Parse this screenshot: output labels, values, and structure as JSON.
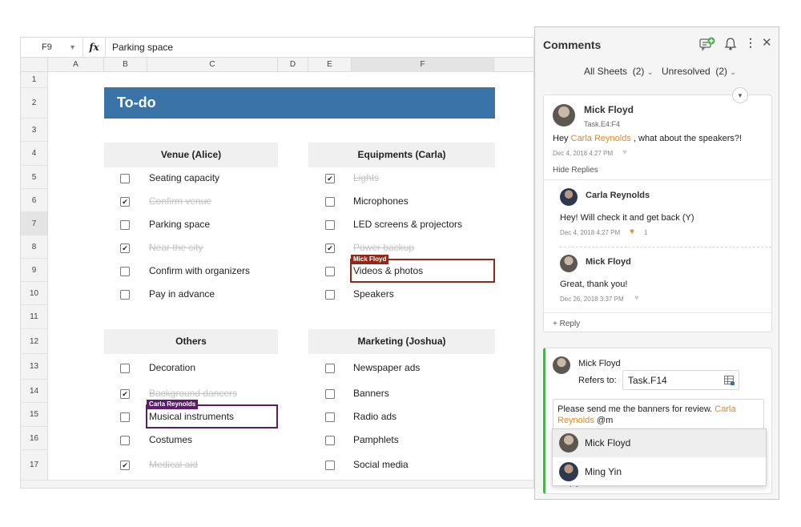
{
  "formula_bar": {
    "cell_ref": "F9",
    "fx_label": "fx",
    "content": "Parking space"
  },
  "columns": [
    "A",
    "B",
    "C",
    "D",
    "E",
    "F"
  ],
  "rows": [
    "1",
    "2",
    "3",
    "4",
    "5",
    "6",
    "7",
    "8",
    "9",
    "10",
    "11",
    "12",
    "13",
    "14",
    "15",
    "16",
    "17"
  ],
  "sheet_title": "To-do",
  "sections": {
    "venue": "Venue (Alice)",
    "equipments": "Equipments (Carla)",
    "others": "Others",
    "marketing": "Marketing (Joshua)"
  },
  "tasks": {
    "venue": [
      {
        "label": "Seating capacity",
        "checked": false
      },
      {
        "label": "Confirm venue",
        "checked": true
      },
      {
        "label": "Parking space",
        "checked": false
      },
      {
        "label": "Near the city",
        "checked": true
      },
      {
        "label": "Confirm with organizers",
        "checked": false
      },
      {
        "label": "Pay in advance",
        "checked": false
      }
    ],
    "equipments": [
      {
        "label": "Lights",
        "checked": true
      },
      {
        "label": "Microphones",
        "checked": false
      },
      {
        "label": "LED screens & projectors",
        "checked": false
      },
      {
        "label": "Power backup",
        "checked": true
      },
      {
        "label": "Videos & photos",
        "checked": false
      },
      {
        "label": "Speakers",
        "checked": false
      }
    ],
    "others": [
      {
        "label": "Decoration",
        "checked": false
      },
      {
        "label": "Background dancers",
        "checked": true
      },
      {
        "label": "Musical instruments",
        "checked": false
      },
      {
        "label": "Costumes",
        "checked": false
      },
      {
        "label": "Medical aid",
        "checked": true
      }
    ],
    "marketing": [
      {
        "label": "Newspaper ads",
        "checked": false
      },
      {
        "label": "Banners",
        "checked": false
      },
      {
        "label": "Radio ads",
        "checked": false
      },
      {
        "label": "Pamphlets",
        "checked": false
      },
      {
        "label": "Social media",
        "checked": false
      }
    ]
  },
  "collab_tags": {
    "mick": "Mick Floyd",
    "carla": "Carla Reynolds"
  },
  "colors": {
    "title_band": "#3a73a8",
    "mick_tag": "#8e2a1c",
    "carla_tag": "#5b1d6b",
    "mention": "#e08a2a",
    "new_comment_accent": "#4caf50"
  },
  "panel": {
    "title": "Comments",
    "filter_sheets": "All Sheets",
    "filter_sheets_count": "(2)",
    "filter_status": "Unresolved",
    "filter_status_count": "(2)",
    "thread": {
      "author": "Mick Floyd",
      "ref": "Task.E4:F4",
      "text_pre": "Hey ",
      "mention": "Carla Reynolds",
      "text_post": " , what about the speakers?!",
      "date": "Dec 4, 2018 4:27 PM",
      "hide_replies": "Hide Replies",
      "replies": [
        {
          "author": "Carla Reynolds",
          "text": "Hey! Will check it and get back (Y)",
          "date": "Dec 4, 2018 4:27 PM",
          "likes": "1"
        },
        {
          "author": "Mick Floyd",
          "text": "Great, thank you!",
          "date": "Dec 26, 2018 3:37 PM"
        }
      ],
      "reply_link": "+ Reply"
    },
    "new_comment": {
      "author": "Mick Floyd",
      "refers_label": "Refers to:",
      "refers_value": "Task.F14",
      "text_pre": "Please send me the banners for review. ",
      "mention_part1": "Carla",
      "mention_part2": "Reynolds",
      "text_post": " @m",
      "suggestions": [
        "Mick Floyd",
        "Ming Yin"
      ],
      "reply_link": "+ Reply"
    }
  }
}
